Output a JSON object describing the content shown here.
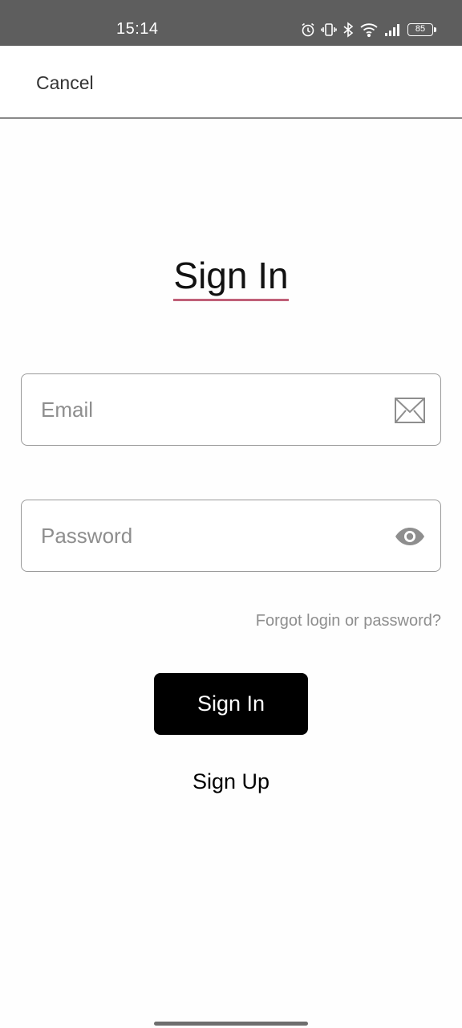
{
  "status_bar": {
    "time": "15:14",
    "icons": [
      "alarm-icon",
      "vibrate-icon",
      "bluetooth-icon",
      "wifi-icon",
      "signal-icon",
      "battery-icon"
    ],
    "battery_level": "85"
  },
  "top_bar": {
    "cancel_label": "Cancel"
  },
  "page": {
    "title": "Sign In",
    "email": {
      "placeholder": "Email",
      "value": "",
      "icon": "mail-icon"
    },
    "password": {
      "placeholder": "Password",
      "value": "",
      "icon": "eye-icon"
    },
    "forgot_label": "Forgot login or password?",
    "sign_in_label": "Sign In",
    "sign_up_label": "Sign Up"
  },
  "colors": {
    "status_bar_bg": "#5e5e5e",
    "title_underline": "#c06078",
    "primary_button_bg": "#000000",
    "placeholder_text": "#8e8e8e",
    "field_border": "#9a9a9a"
  }
}
